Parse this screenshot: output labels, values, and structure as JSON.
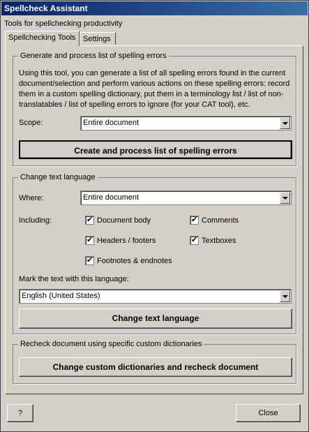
{
  "window": {
    "title": "Spellcheck Assistant",
    "subtitle": "Tools for spellchecking productivity"
  },
  "tabs": [
    {
      "label": "Spellchecking Tools",
      "active": true
    },
    {
      "label": "Settings",
      "active": false
    }
  ],
  "group1": {
    "legend": "Generate and process list of spelling errors",
    "description": "Using this tool, you can generate a list of all spelling errors found in the current document/selection and perform various actions on these spelling errors: record them in a custom spelling dictionary, put them in a terminology list / list of non-translatables / list of spelling errors to ignore (for your CAT tool), etc.",
    "scope_label": "Scope:",
    "scope_value": "Entire document",
    "button": "Create and process list of spelling errors"
  },
  "group2": {
    "legend": "Change text language",
    "where_label": "Where:",
    "where_value": "Entire document",
    "including_label": "Including:",
    "checkboxes": [
      {
        "label": "Document body",
        "checked": true
      },
      {
        "label": "Comments",
        "checked": true
      },
      {
        "label": "Headers / footers",
        "checked": true
      },
      {
        "label": "Textboxes",
        "checked": true
      },
      {
        "label": "Footnotes & endnotes",
        "checked": true
      }
    ],
    "mark_label": "Mark the text with this language:",
    "language_value": "English (United States)",
    "button": "Change text language"
  },
  "group3": {
    "legend": "Recheck document using specific custom dictionaries",
    "button": "Change custom dictionaries and recheck document"
  },
  "footer": {
    "help_label": "?",
    "close_label": "Close"
  }
}
